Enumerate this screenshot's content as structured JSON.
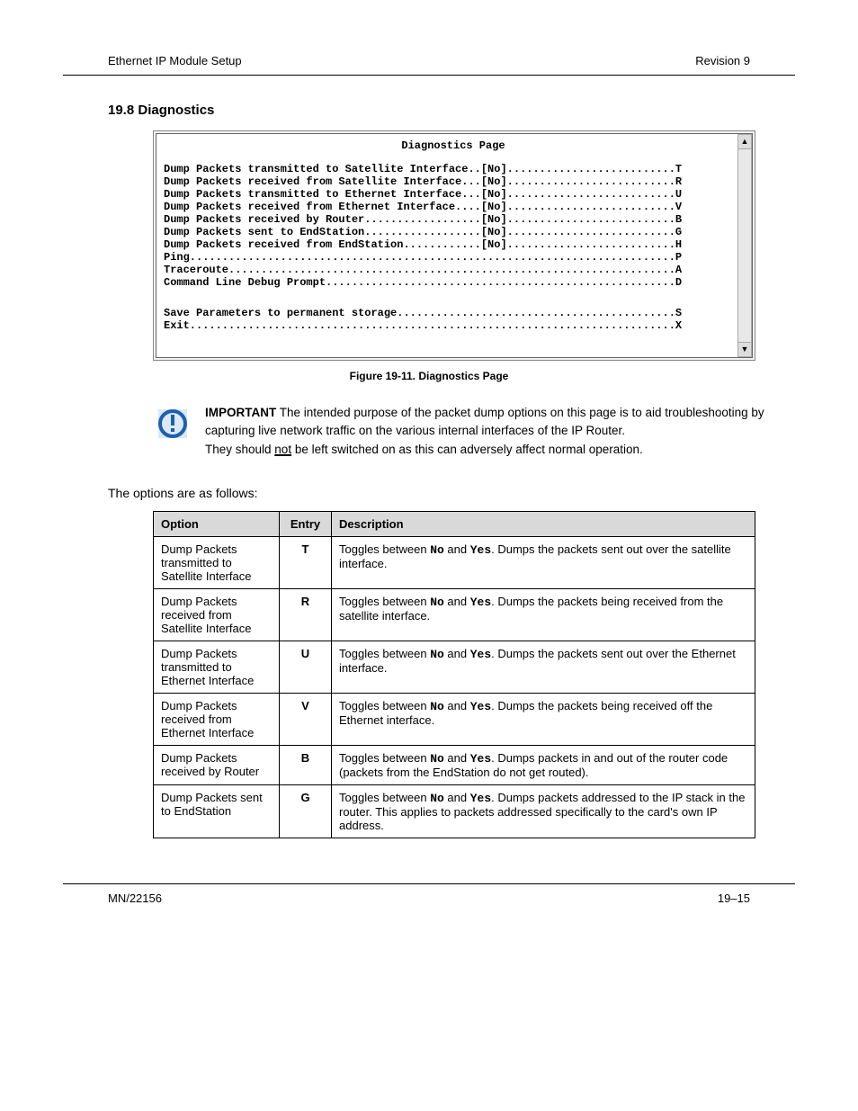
{
  "header": {
    "left": "Ethernet IP Module Setup",
    "right": "Revision 9"
  },
  "section": {
    "title": "19.8 Diagnostics"
  },
  "diag": {
    "title": "Diagnostics Page",
    "lines": [
      "Dump Packets transmitted to Satellite Interface..[No]..........................T",
      "Dump Packets received from Satellite Interface...[No]..........................R",
      "Dump Packets transmitted to Ethernet Interface...[No]..........................U",
      "Dump Packets received from Ethernet Interface....[No]..........................V",
      "Dump Packets received by Router..................[No]..........................B",
      "Dump Packets sent to EndStation..................[No]..........................G",
      "Dump Packets received from EndStation............[No]..........................H",
      "Ping...........................................................................P",
      "Traceroute.....................................................................A",
      "Command Line Debug Prompt......................................................D"
    ],
    "lines2": [
      "Save Parameters to permanent storage...........................................S",
      "Exit...........................................................................X"
    ]
  },
  "caption": "Figure 19-11. Diagnostics Page",
  "note": {
    "bold1": "IMPORTANT",
    "text1": "The intended purpose of the packet dump options on this page is to aid troubleshooting by capturing live network traffic on the various internal interfaces of the IP Router.",
    "text2": "They should ",
    "underAll": "not",
    "afterAll": " be left switched on as this can adversely affect normal operation."
  },
  "intro": "The options are as follows:",
  "table": {
    "headers": [
      "Option",
      "Entry",
      "Description"
    ],
    "rows": [
      {
        "opt": "Dump Packets transmitted to Satellite Interface",
        "key": "T",
        "desc_pre": "Toggles between ",
        "m1": "No",
        "and": " and ",
        "m2": "Yes",
        "desc_post": ". Dumps the packets sent out over the satellite interface."
      },
      {
        "opt": "Dump Packets received from Satellite Interface",
        "key": "R",
        "desc_pre": "Toggles between ",
        "m1": "No",
        "and": " and ",
        "m2": "Yes",
        "desc_post": ". Dumps the packets being received from the satellite interface."
      },
      {
        "opt": "Dump Packets transmitted to Ethernet Interface",
        "key": "U",
        "desc_pre": "Toggles between ",
        "m1": "No",
        "and": " and ",
        "m2": "Yes",
        "desc_post": ". Dumps the packets sent out over the Ethernet interface."
      },
      {
        "opt": "Dump Packets received from Ethernet Interface",
        "key": "V",
        "desc_pre": "Toggles between ",
        "m1": "No",
        "and": " and ",
        "m2": "Yes",
        "desc_post": ". Dumps the packets being received off the Ethernet interface."
      },
      {
        "opt": "Dump Packets received by Router",
        "key": "B",
        "desc_pre": "Toggles between ",
        "m1": "No",
        "and": " and ",
        "m2": "Yes",
        "desc_post": ". Dumps packets in and out of the router code (packets from the EndStation do not get routed)."
      },
      {
        "opt": "Dump Packets sent to EndStation",
        "key": "G",
        "desc_pre": "Toggles between ",
        "m1": "No",
        "and": " and ",
        "m2": "Yes",
        "desc_post": ". Dumps packets addressed to the IP stack in the router. This applies to packets addressed specifically to the card's own IP address."
      }
    ]
  },
  "footer": {
    "left": "MN/22156",
    "right": "19–15"
  }
}
